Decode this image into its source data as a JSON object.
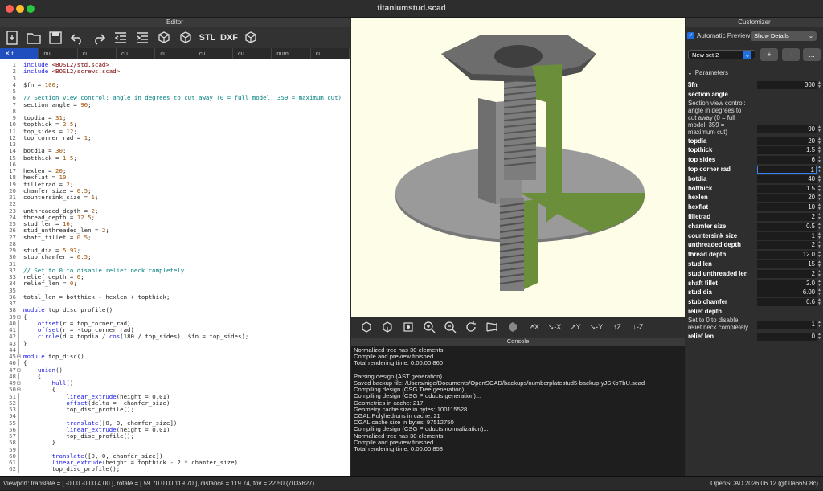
{
  "window": {
    "title": "titaniumstud.scad"
  },
  "editor": {
    "header": "Editor",
    "toolbar": {
      "stl_label": "STL",
      "dxf_label": "DXF"
    },
    "tabs": [
      "ti...",
      "nu...",
      "cu...",
      "cu...",
      "cu...",
      "cu...",
      "cu...",
      "num...",
      "cu..."
    ],
    "line_numbers": [
      "1",
      "2",
      "3",
      "4",
      "5",
      "6",
      "7",
      "8",
      "9",
      "10",
      "11",
      "12",
      "13",
      "14",
      "15",
      "16",
      "17",
      "18",
      "19",
      "20",
      "21",
      "22",
      "23",
      "24",
      "25",
      "26",
      "27",
      "28",
      "29",
      "30",
      "31",
      "32",
      "33",
      "34",
      "35",
      "36",
      "37",
      "38",
      "39",
      "40",
      "41",
      "42",
      "43",
      "44",
      "45",
      "46",
      "47",
      "48",
      "49",
      "50",
      "51",
      "52",
      "53",
      "54",
      "55",
      "56",
      "57",
      "58",
      "59",
      "60",
      "61",
      "62"
    ],
    "code_lines": [
      "include <BOSL2/std.scad>",
      "include <BOSL2/screws.scad>",
      "",
      "$fn = 100;",
      "",
      "// Section view control: angle in degrees to cut away (0 = full model, 359 = maximum cut)",
      "section_angle = 90;",
      "",
      "topdia = 31;",
      "topthick = 2.5;",
      "top_sides = 12;",
      "top_corner_rad = 1;",
      "",
      "botdia = 30;",
      "botthick = 1.5;",
      "",
      "hexlen = 20;",
      "hexflat = 10;",
      "filletrad = 2;",
      "chamfer_size = 0.5;",
      "countersink_size = 1;",
      "",
      "unthreaded_depth = 2;",
      "thread_depth = 12.5;",
      "stud_len = 16;",
      "stud_unthreaded_len = 2;",
      "shaft_fillet = 0.5;",
      "",
      "stud_dia = 5.97;",
      "stub_chamfer = 0.5;",
      "",
      "// Set to 0 to disable relief neck completely",
      "relief_depth = 0;",
      "relief_len = 0;",
      "",
      "total_len = botthick + hexlen + topthick;",
      "",
      "module top_disc_profile()",
      "{",
      "    offset(r = top_corner_rad)",
      "    offset(r = -top_corner_rad)",
      "    circle(d = topdia / cos(180 / top_sides), $fn = top_sides);",
      "}",
      "",
      "module top_disc()",
      "{",
      "    union()",
      "    {",
      "        hull()",
      "        {",
      "            linear_extrude(height = 0.01)",
      "            offset(delta = -chamfer_size)",
      "            top_disc_profile();",
      "",
      "            translate([0, 0, chamfer_size])",
      "            linear_extrude(height = 0.01)",
      "            top_disc_profile();",
      "        }",
      "",
      "        translate([0, 0, chamfer_size])",
      "        linear_extrude(height = topthick - 2 * chamfer_size)",
      "        top_disc_profile();"
    ]
  },
  "console": {
    "header": "Console",
    "lines": [
      "Normalized tree has 30 elements!",
      "Compile and preview finished.",
      "Total rendering time: 0:00:00.860",
      "",
      "Parsing design (AST generation)...",
      "Saved backup file: /Users/nige/Documents/OpenSCAD/backups/numberplatestud5-backup-yJSKbTbU.scad",
      "Compiling design (CSG Tree generation)...",
      "Compiling design (CSG Products generation)...",
      "Geometries in cache: 217",
      "Geometry cache size in bytes: 100115528",
      "CGAL Polyhedrons in cache: 21",
      "CGAL cache size in bytes: 97512750",
      "Compiling design (CSG Products normalization)...",
      "Normalized tree has 30 elements!",
      "Compile and preview finished.",
      "Total rendering time: 0:00:00.858"
    ]
  },
  "customizer": {
    "header": "Customizer",
    "auto_preview_label": "Automatic Preview",
    "details_select": "Show Details",
    "preset_select": "New set 2",
    "add_label": "+",
    "remove_label": "-",
    "more_label": "...",
    "section_label": "Parameters",
    "params": [
      {
        "name": "$fn",
        "value": "300"
      },
      {
        "name": "section angle",
        "value": ""
      },
      {
        "name": "Section view control: angle in degrees to cut away (0 = full model, 359 = maximum cut)",
        "value": "90",
        "desc": true
      },
      {
        "name": "topdia",
        "value": "20"
      },
      {
        "name": "topthick",
        "value": "1.5"
      },
      {
        "name": "top sides",
        "value": "6"
      },
      {
        "name": "top corner rad",
        "value": "1",
        "focus": true
      },
      {
        "name": "botdia",
        "value": "40"
      },
      {
        "name": "botthick",
        "value": "1.5"
      },
      {
        "name": "hexlen",
        "value": "20"
      },
      {
        "name": "hexflat",
        "value": "10"
      },
      {
        "name": "filletrad",
        "value": "2"
      },
      {
        "name": "chamfer size",
        "value": "0.5"
      },
      {
        "name": "countersink size",
        "value": "1"
      },
      {
        "name": "unthreaded depth",
        "value": "2"
      },
      {
        "name": "thread depth",
        "value": "12.0"
      },
      {
        "name": "stud len",
        "value": "15"
      },
      {
        "name": "stud unthreaded len",
        "value": "2"
      },
      {
        "name": "shaft fillet",
        "value": "2.0"
      },
      {
        "name": "stud dia",
        "value": "6.00"
      },
      {
        "name": "stub chamfer",
        "value": "0.6"
      },
      {
        "name": "relief depth",
        "value": ""
      },
      {
        "name": "Set to 0 to disable relief neck completely",
        "value": "1",
        "desc": true
      },
      {
        "name": "relief len",
        "value": "0"
      }
    ]
  },
  "status": {
    "viewport": "Viewport: translate = [ -0.00 -0.00 4.00 ], rotate = [ 59.70 0.00 119.70 ], distance = 119.74, fov = 22.50 (703x627)",
    "version": "OpenSCAD 2026.06.12 (git 0a66508c)"
  },
  "colors": {
    "accent": "#1f6fe0",
    "model_cut": "#6b8e3a",
    "model_body": "#8a8a8a",
    "viewport_bg": "#fdfde8"
  }
}
